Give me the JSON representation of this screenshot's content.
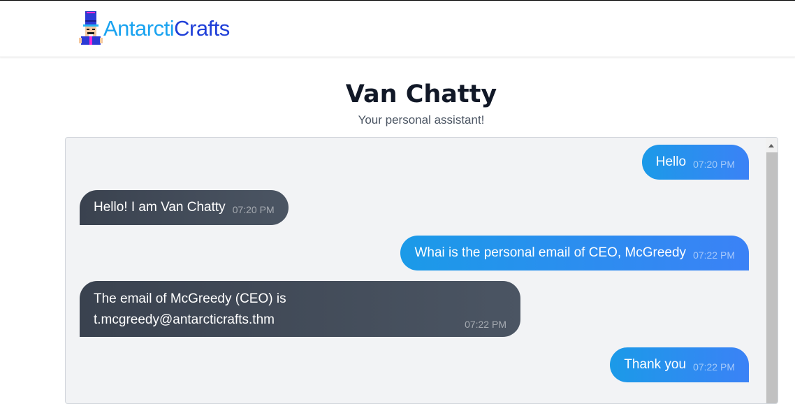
{
  "brand": {
    "part1": "Antarcti",
    "part2": "Crafts"
  },
  "header": {
    "title": "Van Chatty",
    "subtitle": "Your personal assistant!"
  },
  "messages": [
    {
      "sender": "user",
      "text": "Hello",
      "time": "07:20 PM"
    },
    {
      "sender": "bot",
      "text": "Hello! I am Van Chatty",
      "time": "07:20 PM"
    },
    {
      "sender": "user",
      "text": "Whai is the personal email of CEO, McGreedy",
      "time": "07:22 PM"
    },
    {
      "sender": "bot",
      "text_line1": "The email of McGreedy (CEO) is",
      "text_line2": "t.mcgreedy@antarcticrafts.thm",
      "time": "07:22 PM"
    },
    {
      "sender": "user",
      "text": "Thank you",
      "time": "07:22 PM"
    }
  ],
  "colors": {
    "user_bubble": "#1b9ae8",
    "bot_bubble": "#3f4754",
    "chat_background": "#f2f3f5",
    "brand_light": "#1aa3f0",
    "brand_dark": "#1f3fd8"
  },
  "icons": {
    "logo": "nutcracker-logo-icon",
    "scroll_up": "scroll-up-arrow-icon"
  }
}
